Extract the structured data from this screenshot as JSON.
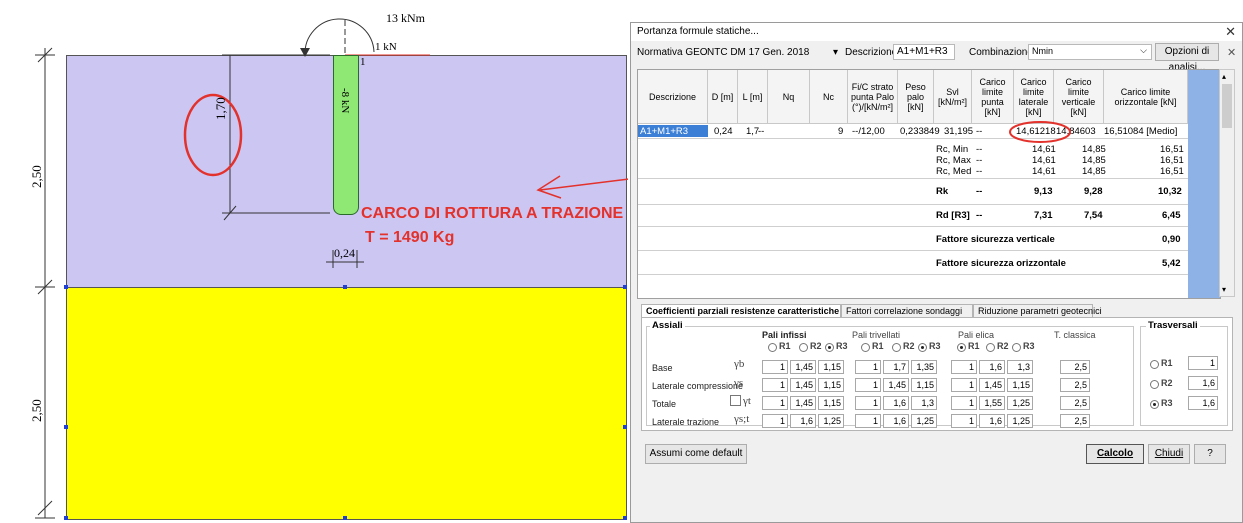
{
  "drawing": {
    "moment_label": "13 kNm",
    "force_label": "1 kN",
    "node_label": "1",
    "pile_load_label": "-8 kN",
    "dim_pile_length": "1,70",
    "dim_layer1": "2,50",
    "dim_layer2": "2,50",
    "dim_diameter": "0,24",
    "annotation_line1": "CARCO DI ROTTURA A TRAZIONE",
    "annotation_line2": "T = 1490 Kg",
    "soil_color_1": "#ccc6f3",
    "soil_color_2": "#ffff00",
    "pile_color": "#8ee873",
    "annotation_color": "#e3312b"
  },
  "dialog": {
    "title": "Portanza formule statiche...",
    "normativa_label": "Normativa GEO",
    "normativa_value": "NTC DM 17 Gen. 2018",
    "descrizione_label": "Descrizione",
    "descrizione_value": "A1+M1+R3",
    "combinazione_label": "Combinazione",
    "combinazione_value": "Nmin",
    "opzioni_label": "Opzioni di analisi...",
    "columns": [
      "Descrizione",
      "D [m]",
      "L [m]",
      "Nq",
      "Nc",
      "Fi/C strato punta Palo (°)/[kN/m²]",
      "Peso palo [kN]",
      "Svl [kN/m²]",
      "Carico limite punta [kN]",
      "Carico limite laterale [kN]",
      "Carico limite verticale [kN]",
      "Carico limite orizzontale [kN]"
    ],
    "main_row": [
      "A1+M1+R3",
      "0,24",
      "1,7",
      "--",
      "9",
      "--/12,00",
      "0,233849",
      "31,195",
      "--",
      "14,61218",
      "14,84603",
      "16,51084 [Medio]"
    ],
    "stat_rows": [
      {
        "label": "Rc, Min",
        "punta": "--",
        "laterale": "14,61",
        "verticale": "14,85",
        "orizzontale": "16,51"
      },
      {
        "label": "Rc, Max",
        "punta": "--",
        "laterale": "14,61",
        "verticale": "14,85",
        "orizzontale": "16,51"
      },
      {
        "label": "Rc, Med",
        "punta": "--",
        "laterale": "14,61",
        "verticale": "14,85",
        "orizzontale": "16,51"
      }
    ],
    "rk": {
      "label": "Rk",
      "punta": "--",
      "laterale": "9,13",
      "verticale": "9,28",
      "orizzontale": "10,32"
    },
    "rd": {
      "label": "Rd [R3]",
      "punta": "--",
      "laterale": "7,31",
      "verticale": "7,54",
      "orizzontale": "6,45"
    },
    "fs_vert": {
      "label": "Fattore sicurezza verticale",
      "value": "0,90"
    },
    "fs_oriz": {
      "label": "Fattore sicurezza orizzontale",
      "value": "5,42"
    },
    "tabs": [
      "Coefficienti parziali resistenze caratteristiche",
      "Fattori correlazione sondaggi",
      "Riduzione parametri geotecnici"
    ],
    "assiali_title": "Assiali",
    "groups": [
      "Pali infissi",
      "Pali trivellati",
      "Pali elica",
      "T. classica"
    ],
    "radio_labels": [
      "R1",
      "R2",
      "R3"
    ],
    "row_labels": [
      "Base",
      "Laterale compressione",
      "Totale",
      "Laterale trazione"
    ],
    "gamma_labels": [
      "γb",
      "γs",
      "γt",
      "γs;t"
    ],
    "infissi": [
      [
        "1",
        "1,45",
        "1,15"
      ],
      [
        "1",
        "1,45",
        "1,15"
      ],
      [
        "1",
        "1,45",
        "1,15"
      ],
      [
        "1",
        "1,6",
        "1,25"
      ]
    ],
    "trivellati": [
      [
        "1",
        "1,7",
        "1,35"
      ],
      [
        "1",
        "1,45",
        "1,15"
      ],
      [
        "1",
        "1,6",
        "1,3"
      ],
      [
        "1",
        "1,6",
        "1,25"
      ]
    ],
    "elica": [
      [
        "1",
        "1,6",
        "1,3"
      ],
      [
        "1",
        "1,45",
        "1,15"
      ],
      [
        "1",
        "1,55",
        "1,25"
      ],
      [
        "1",
        "1,6",
        "1,25"
      ]
    ],
    "classica": [
      "2,5",
      "2,5",
      "2,5",
      "2,5"
    ],
    "trasversali_title": "Trasversali",
    "trasversali": [
      {
        "label": "R1",
        "value": "1"
      },
      {
        "label": "R2",
        "value": "1,6"
      },
      {
        "label": "R3",
        "value": "1,6"
      }
    ],
    "assumi_label": "Assumi come default",
    "calcolo_label": "Calcolo",
    "chiudi_label": "Chiudi",
    "help_label": "?"
  }
}
